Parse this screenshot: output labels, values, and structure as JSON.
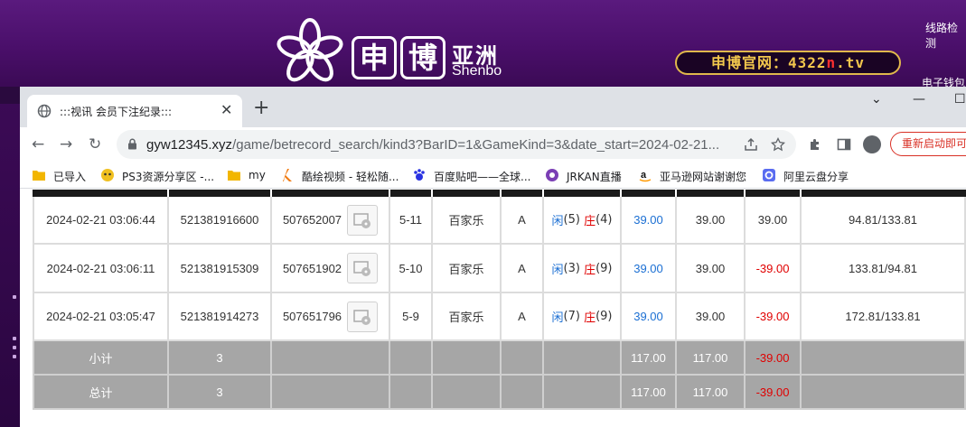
{
  "site": {
    "logo_char1": "申",
    "logo_char2": "博",
    "logo_asia": "亚洲",
    "logo_shenbo": "Shenbo",
    "official_prefix": "申博官网：4322",
    "official_red": "n",
    "official_suffix": ".tv",
    "line_check": "线路检测",
    "e_wallet": "电子钱包"
  },
  "browser": {
    "tab_title": ":::视讯 会员下注纪录:::",
    "url_host": "gyw12345.xyz",
    "url_path": "/game/betrecord_search/kind3?BarID=1&GameKind=3&date_start=2024-02-21...",
    "restart_label": "重新启动即可",
    "bookmarks": [
      {
        "label": "已导入",
        "icon": "folder-icon"
      },
      {
        "label": "PS3资源分享区 -...",
        "icon": "ps3-icon"
      },
      {
        "label": "my",
        "icon": "folder-icon"
      },
      {
        "label": "酷绘视频 - 轻松随...",
        "icon": "k-logo-icon"
      },
      {
        "label": "百度贴吧——全球...",
        "icon": "baidu-icon"
      },
      {
        "label": "JRKAN直播",
        "icon": "jrkan-icon"
      },
      {
        "label": "亚马逊网站谢谢您",
        "icon": "amazon-icon"
      },
      {
        "label": "阿里云盘分享",
        "icon": "aliyun-icon"
      }
    ]
  },
  "table": {
    "rows": [
      {
        "time": "2024-02-21 03:06:44",
        "order": "521381916600",
        "round": "507652007",
        "table_no": "5-11",
        "game": "百家乐",
        "type": "A",
        "player_label": "闲",
        "player_val": "(5)",
        "banker_label": "庄",
        "banker_val": "(4)",
        "bet": "39.00",
        "valid": "39.00",
        "win": "39.00",
        "balance": "94.81/133.81"
      },
      {
        "time": "2024-02-21 03:06:11",
        "order": "521381915309",
        "round": "507651902",
        "table_no": "5-10",
        "game": "百家乐",
        "type": "A",
        "player_label": "闲",
        "player_val": "(3)",
        "banker_label": "庄",
        "banker_val": "(9)",
        "bet": "39.00",
        "valid": "39.00",
        "win": "-39.00",
        "balance": "133.81/94.81"
      },
      {
        "time": "2024-02-21 03:05:47",
        "order": "521381914273",
        "round": "507651796",
        "table_no": "5-9",
        "game": "百家乐",
        "type": "A",
        "player_label": "闲",
        "player_val": "(7)",
        "banker_label": "庄",
        "banker_val": "(9)",
        "bet": "39.00",
        "valid": "39.00",
        "win": "-39.00",
        "balance": "172.81/133.81"
      }
    ],
    "subtotal": {
      "label": "小计",
      "count": "3",
      "bet": "117.00",
      "valid": "117.00",
      "win": "-39.00"
    },
    "total": {
      "label": "总计",
      "count": "3",
      "bet": "117.00",
      "valid": "117.00",
      "win": "-39.00"
    }
  },
  "colors": {
    "accent_purple": "#4a0f6a",
    "win_positive": "#1b6fd3",
    "win_negative": "#e00000",
    "total_row_bg": "#a6a6a6"
  }
}
